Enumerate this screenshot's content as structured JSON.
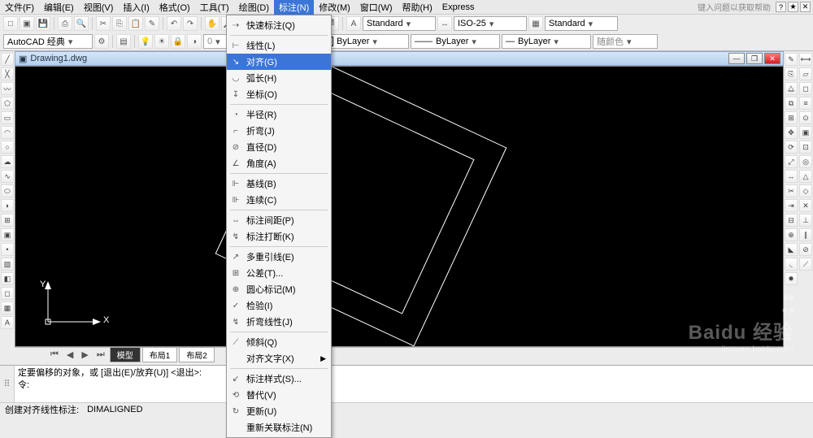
{
  "menubar": {
    "items": [
      "文件(F)",
      "编辑(E)",
      "视图(V)",
      "插入(I)",
      "格式(O)",
      "工具(T)",
      "绘图(D)",
      "标注(N)",
      "修改(M)",
      "窗口(W)",
      "帮助(H)",
      "Express"
    ],
    "open_index": 7,
    "search_hint": "键入问题以获取帮助",
    "right_icons": [
      "?",
      "★",
      "✕"
    ]
  },
  "toolbar_top": {
    "style_dd": "Standard",
    "dim_dd": "ISO-25",
    "table_dd": "Standard"
  },
  "toolbar_second": {
    "workspace": "AutoCAD 经典",
    "layer_dd": "ByLayer",
    "linetype_dd": "ByLayer",
    "lineweight_dd": "ByLayer",
    "color_dd": "随颜色"
  },
  "dropdown": {
    "highlight_index": 2,
    "groups": [
      [
        {
          "ico": "⇢",
          "label": "快速标注(Q)"
        }
      ],
      [
        {
          "ico": "⊢",
          "label": "线性(L)"
        },
        {
          "ico": "↘",
          "label": "对齐(G)"
        },
        {
          "ico": "◡",
          "label": "弧长(H)"
        },
        {
          "ico": "↧",
          "label": "坐标(O)"
        }
      ],
      [
        {
          "ico": "◔",
          "label": "半径(R)"
        },
        {
          "ico": "⌐",
          "label": "折弯(J)"
        },
        {
          "ico": "⊘",
          "label": "直径(D)"
        },
        {
          "ico": "∠",
          "label": "角度(A)"
        }
      ],
      [
        {
          "ico": "⊩",
          "label": "基线(B)"
        },
        {
          "ico": "⊪",
          "label": "连续(C)"
        }
      ],
      [
        {
          "ico": "⇔",
          "label": "标注间距(P)"
        },
        {
          "ico": "↯",
          "label": "标注打断(K)"
        }
      ],
      [
        {
          "ico": "↗",
          "label": "多重引线(E)"
        },
        {
          "ico": "⊞",
          "label": "公差(T)..."
        },
        {
          "ico": "⊕",
          "label": "圆心标记(M)"
        },
        {
          "ico": "✓",
          "label": "检验(I)"
        },
        {
          "ico": "↯",
          "label": "折弯线性(J)"
        }
      ],
      [
        {
          "ico": "⟋",
          "label": "倾斜(Q)"
        },
        {
          "ico": "",
          "label": "对齐文字(X)",
          "sub": true
        }
      ],
      [
        {
          "ico": "↙",
          "label": "标注样式(S)..."
        },
        {
          "ico": "⟲",
          "label": "替代(V)"
        },
        {
          "ico": "↻",
          "label": "更新(U)"
        },
        {
          "ico": "",
          "label": "重新关联标注(N)"
        }
      ]
    ]
  },
  "docwin": {
    "title": "Drawing1.dwg"
  },
  "canvas": {
    "y_label": "Y",
    "x_label": "X"
  },
  "tabs": {
    "items": [
      "模型",
      "布局1",
      "布局2"
    ],
    "active": 0
  },
  "command": {
    "line1": "定要偏移的对象，或 [退出(E)/放弃(U)] <退出>:",
    "line2": "令:",
    "line3": ""
  },
  "status": {
    "left": "创建对齐线性标注:",
    "cmd": "DIMALIGNED"
  },
  "watermark": {
    "brand": "Baidu 经验",
    "sub": "jingyan.baidu.com"
  }
}
